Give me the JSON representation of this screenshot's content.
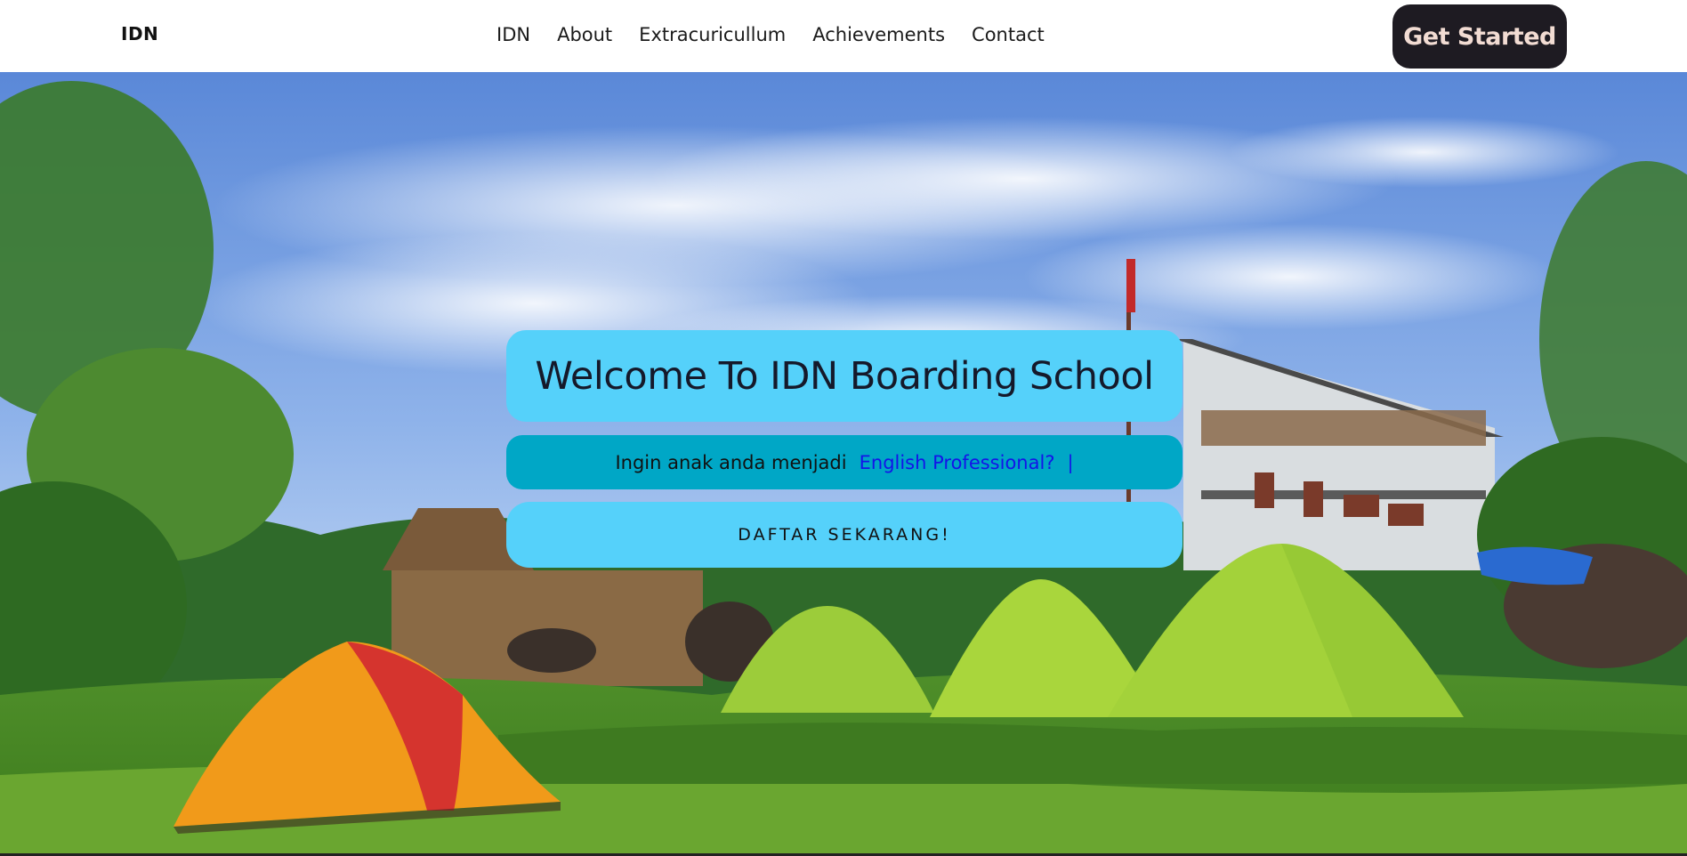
{
  "navbar": {
    "brand": "IDN",
    "links": [
      "IDN",
      "About",
      "Extracuricullum",
      "Achievements",
      "Contact"
    ],
    "cta_label": "Get Started"
  },
  "hero": {
    "title": "Welcome To IDN Boarding School",
    "subtitle_static": "Ingin anak anda menjadi",
    "subtitle_typed": "English Professional?",
    "subtitle_cursor": "|",
    "register_label": "DAFTAR SEKARANG!",
    "background_image": "campsite-tents-building-photo"
  },
  "colors": {
    "cta_bg": "#1e1b22",
    "cta_text": "#f2dcd3",
    "card_light": "#55d1fa",
    "card_dark": "#00a7c6",
    "typed_text": "#1414e8"
  }
}
